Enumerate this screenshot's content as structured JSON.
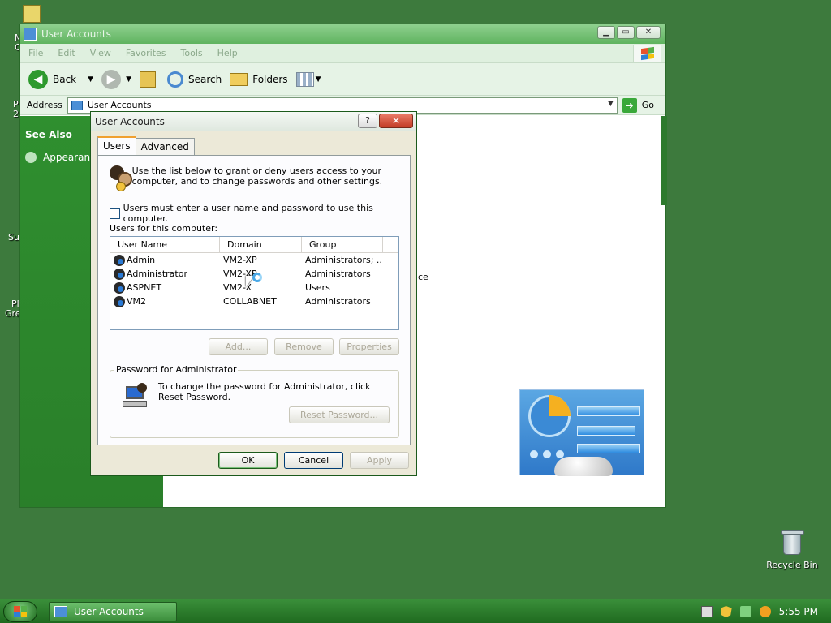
{
  "desktop": {
    "recycle_bin_label": "Recycle Bin",
    "edge_labels": [
      "M",
      "C",
      "P",
      "2",
      "Su",
      "Pl",
      "Gre"
    ]
  },
  "explorer": {
    "title": "User Accounts",
    "menu": [
      "File",
      "Edit",
      "View",
      "Favorites",
      "Tools",
      "Help"
    ],
    "toolbar": {
      "back_label": "Back",
      "search_label": "Search",
      "folders_label": "Folders"
    },
    "address": {
      "label": "Address",
      "value": "User Accounts",
      "go_label": "Go"
    },
    "sidebar": {
      "header": "See Also",
      "items": [
        {
          "label": "Appearance"
        }
      ]
    },
    "stray_text": "ce"
  },
  "dialog": {
    "title": "User Accounts",
    "help_button": "?",
    "close_button": "✕",
    "tabs": [
      {
        "label": "Users",
        "active": true
      },
      {
        "label": "Advanced",
        "active": false
      }
    ],
    "intro_text": "Use the list below to grant or deny users access to your computer, and to change passwords and other settings.",
    "require_login_label": "Users must enter a user name and password to use this computer.",
    "require_login_checked": false,
    "users_label": "Users for this computer:",
    "columns": [
      "User Name",
      "Domain",
      "Group"
    ],
    "users": [
      {
        "name": "Admin",
        "domain": "VM2-XP",
        "group": "Administrators; ..."
      },
      {
        "name": "Administrator",
        "domain": "VM2-XP",
        "group": "Administrators"
      },
      {
        "name": "ASPNET",
        "domain": "VM2-X",
        "group": "Users"
      },
      {
        "name": "VM2",
        "domain": "COLLABNET",
        "group": "Administrators"
      }
    ],
    "buttons": {
      "add": "Add...",
      "remove": "Remove",
      "properties": "Properties",
      "reset_password": "Reset Password...",
      "ok": "OK",
      "cancel": "Cancel",
      "apply": "Apply"
    },
    "password_group_label": "Password for Administrator",
    "password_text": "To change the password for Administrator, click Reset Password."
  },
  "taskbar": {
    "task_label": "User Accounts",
    "clock": "5:55 PM"
  },
  "colors": {
    "desktop": "#3d7a3d",
    "sidebar": "#2f8f2f",
    "dialog_bg": "#ece9d8"
  }
}
